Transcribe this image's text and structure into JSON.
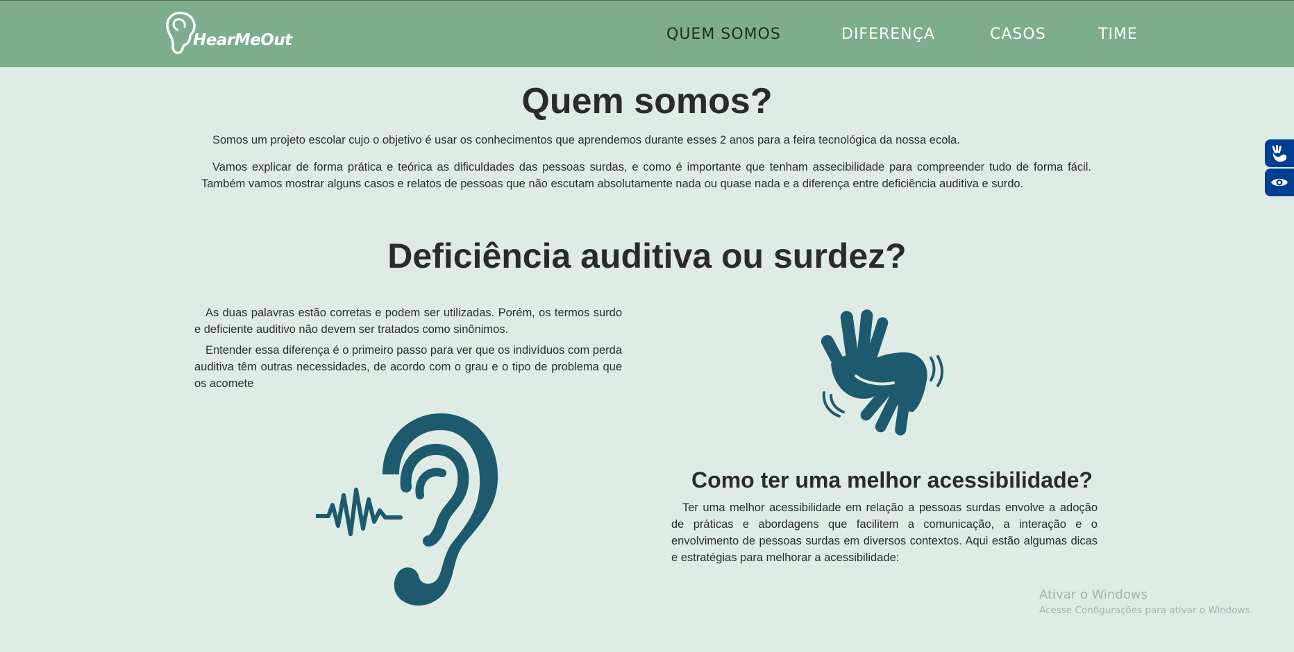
{
  "header": {
    "logo_text": "HearMeOut",
    "nav": [
      {
        "label": "QUEM SOMOS",
        "active": true
      },
      {
        "label": "DIFERENÇA",
        "active": false
      },
      {
        "label": "CASOS",
        "active": false
      },
      {
        "label": "TIME",
        "active": false
      }
    ]
  },
  "quem_somos": {
    "title": "Quem somos?",
    "paragraphs": [
      "Somos um projeto escolar cujo o objetivo é usar os conhecimentos que aprendemos durante esses 2 anos para a feira tecnológica da nossa ecola.",
      "Vamos explicar de forma prática e teórica as dificuldades das pessoas surdas, e como é importante que tenham assecibilidade para compreender tudo de forma fácil. Também vamos mostrar alguns casos e relatos de pessoas que não escutam absolutamente nada ou quase nada e a diferença entre deficiência auditiva e surdo."
    ]
  },
  "deficiencia": {
    "title": "Deficiência auditiva ou surdez?",
    "paragraphs": [
      "As duas palavras estão corretas e podem ser utilizadas. Porém, os termos surdo e deficiente auditivo não devem ser tratados como sinônimos.",
      "Entender essa diferença é o primeiro passo para ver que os indivíduos com perda auditiva têm outras necessidades, de acordo com o grau e o tipo de problema que os acomete"
    ]
  },
  "acessibilidade": {
    "title": "Como ter uma melhor acessibilidade?",
    "paragraph": "Ter uma melhor acessibilidade em relação a pessoas surdas envolve a adoção de práticas e abordagens que facilitem a comunicação, a interação e o envolvimento de pessoas surdas em diversos contextos. Aqui estão algumas dicas e estratégias para melhorar a acessibilidade:"
  },
  "icons": {
    "hands": "sign-language-hands-icon",
    "ear": "ear-sound-wave-icon",
    "side_panel": [
      "sign-language-icon",
      "eye-icon"
    ]
  },
  "colors": {
    "header_bg": "#7dad8d",
    "page_bg": "#dfece5",
    "icon_teal": "#1e5a6e",
    "side_panel_bg": "#003e93"
  },
  "watermark": {
    "title": "Ativar o Windows",
    "subtitle": "Acesse Configurações para ativar o Windows."
  }
}
